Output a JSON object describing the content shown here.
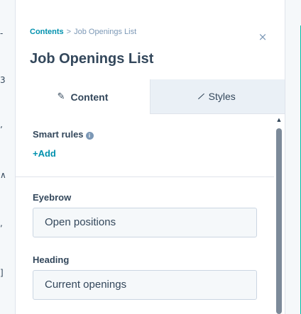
{
  "left_edge": {
    "glyphs": [
      "-",
      "3",
      "ʼ",
      "∧",
      ",",
      "]"
    ]
  },
  "panel": {
    "breadcrumb": {
      "parent": "Contents",
      "separator": ">",
      "current": "Job Openings List"
    },
    "title": "Job Openings List",
    "tabs": [
      {
        "label": "Content",
        "icon": "pencil-icon",
        "glyph": "✎",
        "active": true
      },
      {
        "label": "Styles",
        "icon": "brush-icon",
        "glyph": "∕",
        "active": false
      }
    ],
    "smart_rules": {
      "label": "Smart rules",
      "info_glyph": "i",
      "add_label": "+Add"
    },
    "fields": [
      {
        "label": "Eyebrow",
        "value": "Open positions"
      },
      {
        "label": "Heading",
        "value": "Current openings"
      }
    ],
    "close_glyph": "×",
    "scroll_up_glyph": "▲"
  },
  "colors": {
    "accent": "#0091ae",
    "text": "#33475b",
    "muted": "#7c98b6",
    "teal_edge": "#00bda5"
  }
}
